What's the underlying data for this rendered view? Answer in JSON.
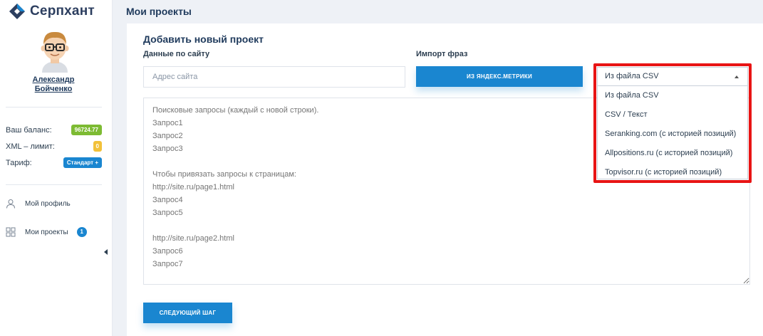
{
  "sidebar": {
    "logo_text": "Серпхант",
    "user_name_line1": "Александр",
    "user_name_line2": "Бойченко",
    "balance_label": "Ваш баланс:",
    "balance_value": "96724.77",
    "xml_limit_label": "XML – лимит:",
    "xml_limit_value": "0",
    "tariff_label": "Тариф:",
    "tariff_value": "Стандарт +",
    "nav": [
      {
        "label": "Мой профиль",
        "icon": "user-icon"
      },
      {
        "label": "Мои проекты",
        "icon": "grid-icon",
        "count": "1"
      }
    ]
  },
  "main": {
    "page_title": "Мои проекты",
    "card_title": "Добавить новый проект",
    "site_data_label": "Данные по сайту",
    "site_input_placeholder": "Адрес сайта",
    "import_label": "Импорт фраз",
    "metrika_button": "ИЗ ЯНДЕКС.МЕТРИКИ",
    "queries_placeholder": "Поисковые запросы (каждый с новой строки).\nЗапрос1\nЗапрос2\nЗапрос3\n\nЧтобы привязать запросы к страницам:\nhttp://site.ru/page1.html\nЗапрос4\nЗапрос5\n\nhttp://site.ru/page2.html\nЗапрос6\nЗапрос7",
    "next_button": "СЛЕДУЮЩИЙ ШАГ"
  },
  "import_dropdown": {
    "selected": "Из файла CSV",
    "options": [
      "Из файла CSV",
      "CSV / Текст",
      "Seranking.com (с историей позиций)",
      "Allpositions.ru (с историей позиций)",
      "Topvisor.ru (с историей позиций)"
    ]
  },
  "colors": {
    "accent": "#1a86d0",
    "highlight": "#e81414",
    "balance_badge": "#7dbb33",
    "limit_badge": "#f2c13a"
  }
}
